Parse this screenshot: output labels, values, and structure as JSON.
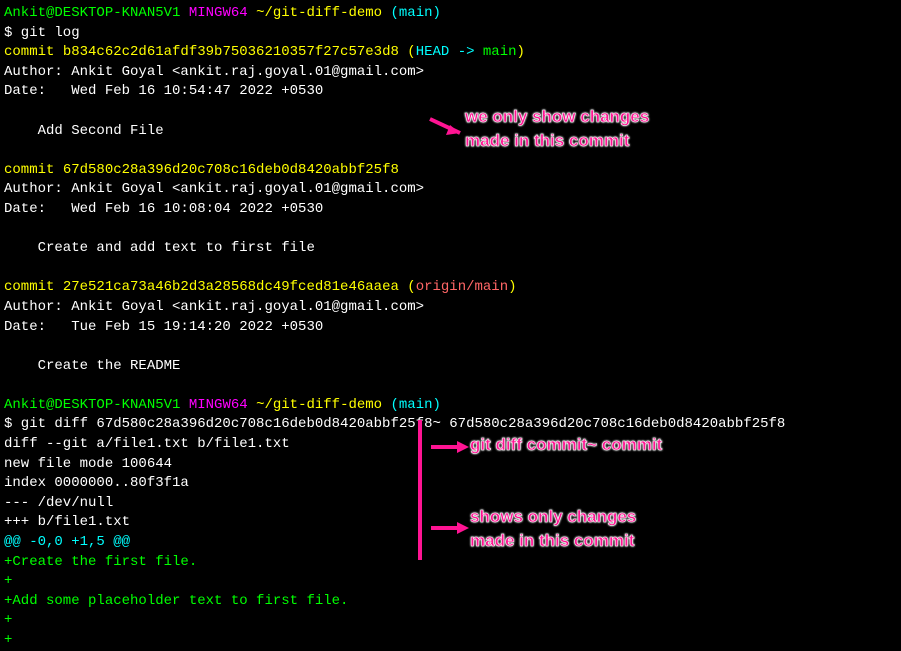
{
  "prompt1": {
    "user": "Ankit@DESKTOP-KNAN5V1",
    "env": "MINGW64",
    "path": "~/git-diff-demo",
    "branch": "(main)"
  },
  "cmd1": "$ git log",
  "commits": [
    {
      "label": "commit ",
      "hash": "b834c62c2d61afdf39b75036210357f27c57e3d8",
      "ref_open": " (",
      "head": "HEAD -> ",
      "branch": "main",
      "ref_close": ")",
      "author": "Author: Ankit Goyal <ankit.raj.goyal.01@gmail.com>",
      "date": "Date:   Wed Feb 16 10:54:47 2022 +0530",
      "msg": "    Add Second File"
    },
    {
      "label": "commit ",
      "hash": "67d580c28a396d20c708c16deb0d8420abbf25f8",
      "author": "Author: Ankit Goyal <ankit.raj.goyal.01@gmail.com>",
      "date": "Date:   Wed Feb 16 10:08:04 2022 +0530",
      "msg": "    Create and add text to first file"
    },
    {
      "label": "commit ",
      "hash": "27e521ca73a46b2d3a28568dc49fced81e46aaea",
      "ref_open": " (",
      "remote": "origin/main",
      "ref_close": ")",
      "author": "Author: Ankit Goyal <ankit.raj.goyal.01@gmail.com>",
      "date": "Date:   Tue Feb 15 19:14:20 2022 +0530",
      "msg": "    Create the README"
    }
  ],
  "prompt2": {
    "user": "Ankit@DESKTOP-KNAN5V1",
    "env": "MINGW64",
    "path": "~/git-diff-demo",
    "branch": "(main)"
  },
  "cmd2": "$ git diff 67d580c28a396d20c708c16deb0d8420abbf25f8~ 67d580c28a396d20c708c16deb0d8420abbf25f8",
  "diff": {
    "header": "diff --git a/file1.txt b/file1.txt",
    "newfile": "new file mode 100644",
    "index": "index 0000000..80f3f1a",
    "minus": "--- /dev/null",
    "plus": "+++ b/file1.txt",
    "hunk": "@@ -0,0 +1,5 @@",
    "add1": "+Create the first file.",
    "add2": "+",
    "add3": "+Add some placeholder text to first file.",
    "add4": "+",
    "add5": "+"
  },
  "annotations": {
    "a1_l1": "we only show changes",
    "a1_l2": "made in this commit",
    "a2": "git diff commit~ commit",
    "a3_l1": "shows only changes",
    "a3_l2": "made in this commit"
  }
}
